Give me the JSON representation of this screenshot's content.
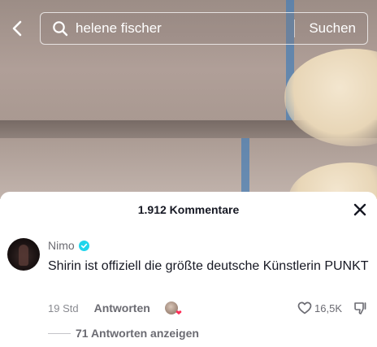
{
  "search": {
    "query": "helene fischer",
    "submit_label": "Suchen"
  },
  "comments_sheet": {
    "count_label": "1.912 Kommentare"
  },
  "comment": {
    "username": "Nimo",
    "verified": true,
    "text": "Shirin ist offiziell die größte deutsche Künstlerin PUNKT",
    "timestamp": "19 Std",
    "reply_label": "Antworten",
    "like_count": "16,5K",
    "view_replies_label": "71 Antworten anzeigen"
  },
  "colors": {
    "accent_verified": "#20d5ec",
    "creator_heart": "#fe2c55",
    "text_primary": "#161823",
    "text_secondary": "#6b6b72"
  },
  "icons": [
    "back-arrow-icon",
    "search-icon",
    "close-icon",
    "verified-icon",
    "heart-icon",
    "dislike-icon"
  ]
}
